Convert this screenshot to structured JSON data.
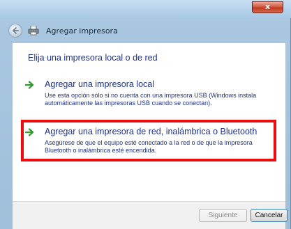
{
  "window": {
    "title": "Agregar impresora",
    "close_label": "x"
  },
  "icons": {
    "back": "back-arrow-icon",
    "printer": "printer-icon",
    "option_arrow": "green-arrow-icon",
    "close": "close-icon"
  },
  "main": {
    "heading": "Elija una impresora local o de red",
    "options": [
      {
        "title": "Agregar una impresora local",
        "description": "Use esta opción sólo si no cuenta con una impresora USB (Windows instala automáticamente las impresoras USB cuando se conectan)."
      },
      {
        "title": "Agregar una impresora de red, inalámbrica o Bluetooth",
        "description": "Asegúrese de que el equipo esté conectado a la red o de que la impresora Bluetooth o inalámbrica esté encendida."
      }
    ]
  },
  "footer": {
    "next_label": "Siguiente",
    "cancel_label": "Cancelar"
  },
  "colors": {
    "highlight": "#ec0e0e",
    "link_text": "#1e3287",
    "arrow": "#2e9c2a"
  }
}
